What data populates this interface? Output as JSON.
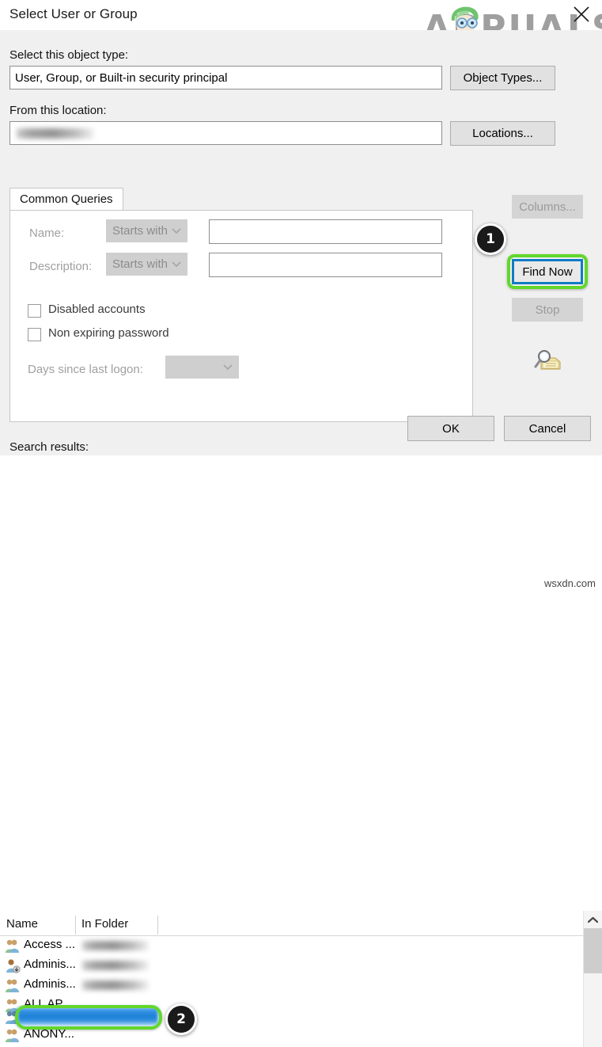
{
  "window": {
    "title": "Select User or Group",
    "close_icon": "close-icon"
  },
  "branding": {
    "logo_text": "APPUALS",
    "watermark": "wsxdn.com"
  },
  "object_type": {
    "label": "Select this object type:",
    "value": "User, Group, or Built-in security principal",
    "button": "Object Types..."
  },
  "location": {
    "label": "From this location:",
    "value": "",
    "button": "Locations..."
  },
  "tabs": [
    {
      "label": "Common Queries"
    }
  ],
  "query": {
    "name_label": "Name:",
    "name_operator": "Starts with",
    "name_value": "",
    "description_label": "Description:",
    "description_operator": "Starts with",
    "description_value": "",
    "disabled_accounts_label": "Disabled accounts",
    "non_expiring_password_label": "Non expiring password",
    "days_since_logon_label": "Days since last logon:",
    "days_since_logon_value": ""
  },
  "actions": {
    "columns": "Columns...",
    "find_now": "Find Now",
    "stop": "Stop",
    "search_icon": "magnifier-folder-icon"
  },
  "dialog_buttons": {
    "ok": "OK",
    "cancel": "Cancel"
  },
  "results": {
    "label": "Search results:",
    "columns": [
      "Name",
      "In Folder"
    ],
    "rows": [
      {
        "name": "Access ...",
        "folder": "",
        "icon": "group-icon",
        "selected": false
      },
      {
        "name": "Adminis...",
        "folder": "",
        "icon": "user-badge-icon",
        "selected": false
      },
      {
        "name": "Adminis...",
        "folder": "",
        "icon": "group-icon",
        "selected": false
      },
      {
        "name": "ALL AP...",
        "folder": "",
        "icon": "group-icon",
        "selected": false
      },
      {
        "name": "",
        "folder": "",
        "icon": "group-icon",
        "selected": true
      },
      {
        "name": "ANONY...",
        "folder": "",
        "icon": "group-icon",
        "selected": false
      }
    ]
  },
  "annotations": {
    "step_one": "1",
    "step_two": "2"
  },
  "colors": {
    "highlight_ring": "#63d72b",
    "focus_border": "#0f7cc4",
    "selection_blue": "#1a7fd4"
  }
}
